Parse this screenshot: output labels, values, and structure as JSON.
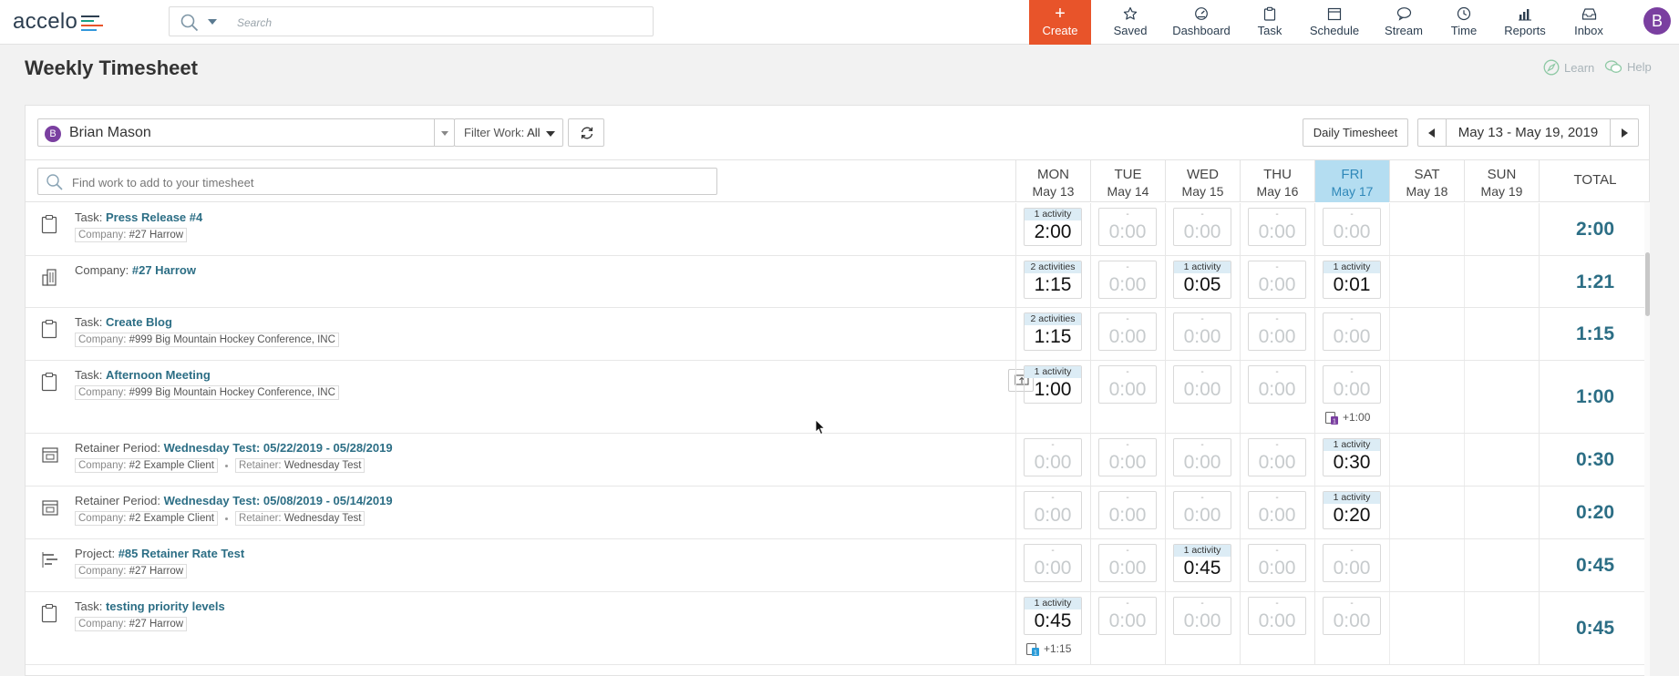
{
  "topbar": {
    "logo_text": "accelo",
    "search_placeholder": "Search",
    "create_label": "Create",
    "nav": [
      {
        "label": "Saved",
        "icon": "star-icon"
      },
      {
        "label": "Dashboard",
        "icon": "dashboard-icon"
      },
      {
        "label": "Task",
        "icon": "clipboard-icon"
      },
      {
        "label": "Schedule",
        "icon": "calendar-icon"
      },
      {
        "label": "Stream",
        "icon": "chat-bubble-icon"
      },
      {
        "label": "Time",
        "icon": "clock-icon"
      },
      {
        "label": "Reports",
        "icon": "bar-chart-icon"
      },
      {
        "label": "Inbox",
        "icon": "inbox-icon"
      }
    ],
    "avatar_initial": "B"
  },
  "page": {
    "title": "Weekly Timesheet",
    "learn_label": "Learn",
    "help_label": "Help"
  },
  "controls": {
    "user_initial": "B",
    "user_name": "Brian Mason",
    "filter_label": "Filter Work:",
    "filter_value": "All",
    "daily_label": "Daily Timesheet",
    "date_range": "May 13 - May 19, 2019",
    "find_placeholder": "Find work to add to your timesheet"
  },
  "days": [
    {
      "dow": "MON",
      "date": "May 13"
    },
    {
      "dow": "TUE",
      "date": "May 14"
    },
    {
      "dow": "WED",
      "date": "May 15"
    },
    {
      "dow": "THU",
      "date": "May 16"
    },
    {
      "dow": "FRI",
      "date": "May 17"
    },
    {
      "dow": "SAT",
      "date": "May 18"
    },
    {
      "dow": "SUN",
      "date": "May 19"
    }
  ],
  "total_label": "TOTAL",
  "rows": [
    {
      "type": "Task:",
      "name": "Press Release #4",
      "icon": "clipboard-icon",
      "tags": [
        {
          "k": "Company:",
          "v": "#27 Harrow"
        }
      ],
      "cells": [
        {
          "a": "1 activity",
          "t": "2:00"
        },
        {
          "a": "-",
          "t": "0:00"
        },
        {
          "a": "-",
          "t": "0:00"
        },
        {
          "a": "-",
          "t": "0:00"
        },
        {
          "a": "-",
          "t": "0:00"
        }
      ],
      "total": "2:00"
    },
    {
      "type": "Company:",
      "name": "#27 Harrow",
      "icon": "building-icon",
      "tags": [],
      "cells": [
        {
          "a": "2 activities",
          "t": "1:15"
        },
        {
          "a": "-",
          "t": "0:00"
        },
        {
          "a": "1 activity",
          "t": "0:05"
        },
        {
          "a": "-",
          "t": "0:00"
        },
        {
          "a": "1 activity",
          "t": "0:01"
        }
      ],
      "total": "1:21"
    },
    {
      "type": "Task:",
      "name": "Create Blog",
      "icon": "clipboard-icon",
      "tags": [
        {
          "k": "Company:",
          "v": "#999 Big Mountain Hockey Conference, INC"
        }
      ],
      "cells": [
        {
          "a": "2 activities",
          "t": "1:15"
        },
        {
          "a": "-",
          "t": "0:00"
        },
        {
          "a": "-",
          "t": "0:00"
        },
        {
          "a": "-",
          "t": "0:00"
        },
        {
          "a": "-",
          "t": "0:00"
        }
      ],
      "total": "1:15"
    },
    {
      "type": "Task:",
      "name": "Afternoon Meeting",
      "icon": "clipboard-icon",
      "tags": [
        {
          "k": "Company:",
          "v": "#999 Big Mountain Hockey Conference, INC"
        }
      ],
      "cells": [
        {
          "a": "1 activity",
          "t": "1:00"
        },
        {
          "a": "-",
          "t": "0:00"
        },
        {
          "a": "-",
          "t": "0:00"
        },
        {
          "a": "-",
          "t": "0:00"
        },
        {
          "a": "-",
          "t": "0:00",
          "extra": "+1:00",
          "badge": "1"
        }
      ],
      "total": "1:00"
    },
    {
      "type": "Retainer Period:",
      "name": "Wednesday Test: 05/22/2019 - 05/28/2019",
      "icon": "retainer-icon",
      "tags": [
        {
          "k": "Company:",
          "v": "#2 Example Client"
        },
        {
          "k": "Retainer:",
          "v": "Wednesday Test"
        }
      ],
      "cells": [
        {
          "a": "-",
          "t": "0:00"
        },
        {
          "a": "-",
          "t": "0:00"
        },
        {
          "a": "-",
          "t": "0:00"
        },
        {
          "a": "-",
          "t": "0:00"
        },
        {
          "a": "1 activity",
          "t": "0:30"
        }
      ],
      "total": "0:30"
    },
    {
      "type": "Retainer Period:",
      "name": "Wednesday Test: 05/08/2019 - 05/14/2019",
      "icon": "retainer-icon",
      "tags": [
        {
          "k": "Company:",
          "v": "#2 Example Client"
        },
        {
          "k": "Retainer:",
          "v": "Wednesday Test"
        }
      ],
      "cells": [
        {
          "a": "-",
          "t": "0:00"
        },
        {
          "a": "-",
          "t": "0:00"
        },
        {
          "a": "-",
          "t": "0:00"
        },
        {
          "a": "-",
          "t": "0:00"
        },
        {
          "a": "1 activity",
          "t": "0:20"
        }
      ],
      "total": "0:20"
    },
    {
      "type": "Project:",
      "name": "#85 Retainer Rate Test",
      "icon": "project-icon",
      "tags": [
        {
          "k": "Company:",
          "v": "#27 Harrow"
        }
      ],
      "cells": [
        {
          "a": "-",
          "t": "0:00"
        },
        {
          "a": "-",
          "t": "0:00"
        },
        {
          "a": "1 activity",
          "t": "0:45"
        },
        {
          "a": "-",
          "t": "0:00"
        },
        {
          "a": "-",
          "t": "0:00"
        }
      ],
      "total": "0:45"
    },
    {
      "type": "Task:",
      "name": "testing priority levels",
      "icon": "clipboard-icon",
      "tags": [
        {
          "k": "Company:",
          "v": "#27 Harrow"
        }
      ],
      "cells": [
        {
          "a": "1 activity",
          "t": "0:45",
          "extra": "+1:15",
          "badge": "1"
        },
        {
          "a": "-",
          "t": "0:00"
        },
        {
          "a": "-",
          "t": "0:00"
        },
        {
          "a": "-",
          "t": "0:00"
        },
        {
          "a": "-",
          "t": "0:00"
        }
      ],
      "total": "0:45"
    }
  ],
  "colors": {
    "brand": "#e8542a",
    "link": "#2c6e85",
    "today": "#b4ddf1"
  }
}
